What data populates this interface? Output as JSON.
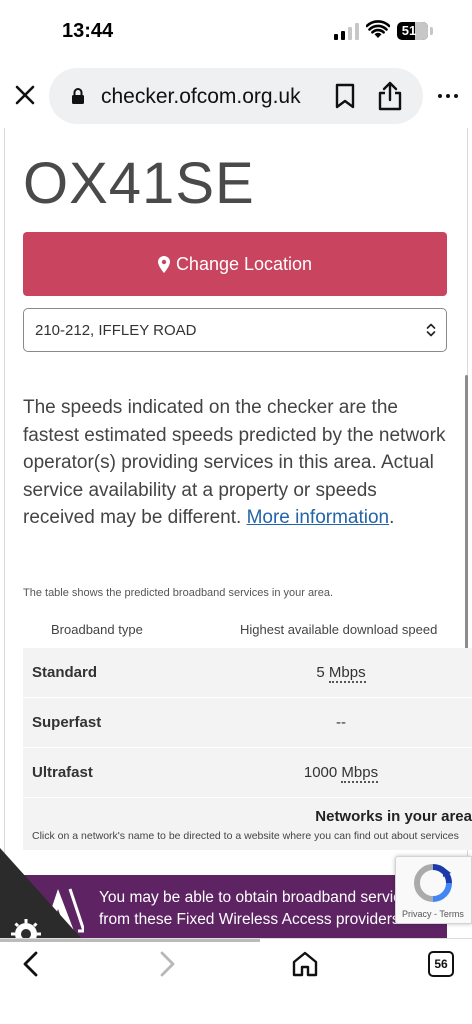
{
  "status_bar": {
    "time": "13:44",
    "battery": "51"
  },
  "browser": {
    "url": "checker.ofcom.org.uk",
    "tab_count": "56"
  },
  "page": {
    "postcode": "OX41SE",
    "change_location_label": "Change Location",
    "address_selected": "210-212, IFFLEY ROAD",
    "info_text": "The speeds indicated on the checker are the fastest estimated speeds predicted by the network operator(s) providing services in this area. Actual service availability at a property or speeds received may be different.",
    "info_link": "More information",
    "info_end": ".",
    "table_note": "The table shows the predicted broadband services in your area.",
    "table": {
      "headers": [
        "Broadband type",
        "Highest available download speed"
      ],
      "rows": [
        {
          "type": "Standard",
          "value": "5",
          "unit": "Mbps"
        },
        {
          "type": "Superfast",
          "value": "--",
          "unit": ""
        },
        {
          "type": "Ultrafast",
          "value": "1000",
          "unit": "Mbps"
        }
      ]
    },
    "networks_title": "Networks in your area",
    "networks_note": "Click on a network's name to be directed to a website where you can find out about services",
    "wireless_banner": "You may be able to obtain broadband services from these Fixed Wireless Access providers",
    "recaptcha_text": "Privacy - Terms"
  },
  "colors": {
    "accent": "#c8445f",
    "banner": "#5e2363",
    "link": "#2464a8"
  }
}
